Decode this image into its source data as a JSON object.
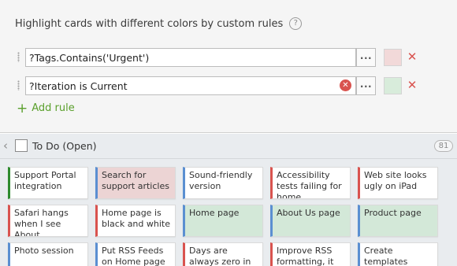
{
  "rules_panel": {
    "title": "Highlight cards with different colors by custom rules",
    "help_icon_glyph": "?",
    "rules": [
      {
        "expression": "?Tags.Contains('Urgent')",
        "color": "#f2d9d9",
        "show_clear": false
      },
      {
        "expression": "?Iteration is Current",
        "color": "#d8ecdb",
        "show_clear": true
      }
    ],
    "ellipsis_label": "...",
    "clear_glyph": "✕",
    "remove_glyph": "✕",
    "add_rule_plus": "+",
    "add_rule_label": "Add rule",
    "colors": {
      "accent_green": "#5aa02c",
      "remove_red": "#d9534f"
    }
  },
  "column": {
    "collapse_glyph": "‹",
    "title": "To Do (Open)",
    "count": "81"
  },
  "card_colors": {
    "green_stripe": "#2e8b2e",
    "blue_stripe": "#5b8fd1",
    "red_stripe": "#d9534f",
    "highlight_red": "#ecd4d4",
    "highlight_green": "#d3e8d8"
  },
  "cards": [
    {
      "text": "Support Portal integration",
      "stripe": "green",
      "bg": "white"
    },
    {
      "text": "Search for support articles",
      "stripe": "blue",
      "bg": "red"
    },
    {
      "text": "Sound-friendly version",
      "stripe": "blue",
      "bg": "white"
    },
    {
      "text": "Accessibility tests failing for home",
      "stripe": "red",
      "bg": "white"
    },
    {
      "text": "Web site looks ugly on iPad",
      "stripe": "red",
      "bg": "white"
    },
    {
      "text": "Safari hangs when I see About",
      "stripe": "red",
      "bg": "white"
    },
    {
      "text": "Home page is black and white",
      "stripe": "red",
      "bg": "white"
    },
    {
      "text": "Home page",
      "stripe": "blue",
      "bg": "green"
    },
    {
      "text": "About Us page",
      "stripe": "blue",
      "bg": "green"
    },
    {
      "text": "Product page",
      "stripe": "blue",
      "bg": "green"
    },
    {
      "text": "Photo session",
      "stripe": "blue",
      "bg": "white"
    },
    {
      "text": "Put RSS Feeds on Home page",
      "stripe": "blue",
      "bg": "white"
    },
    {
      "text": "Days are always zero in RSS block",
      "stripe": "red",
      "bg": "white"
    },
    {
      "text": "Improve RSS formatting, it",
      "stripe": "red",
      "bg": "white"
    },
    {
      "text": "Create templates",
      "stripe": "blue",
      "bg": "white"
    }
  ]
}
